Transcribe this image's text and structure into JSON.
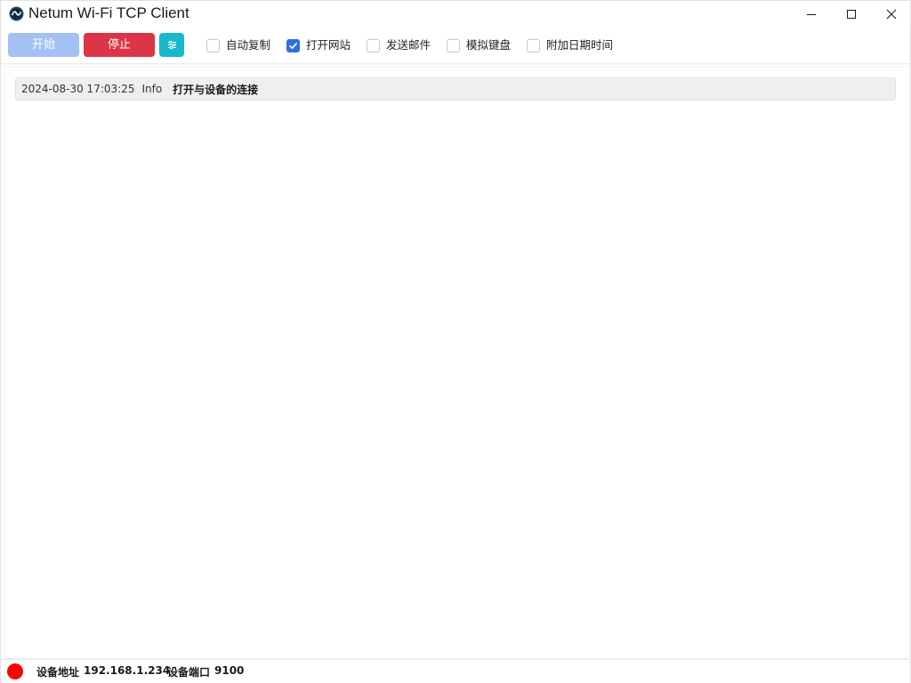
{
  "window": {
    "title": "Netum Wi-Fi TCP Client",
    "icon": "netum-logo-icon",
    "controls": {
      "minimize": "minimize-icon",
      "maximize": "maximize-icon",
      "close": "close-icon"
    }
  },
  "toolbar": {
    "start_label": "开始",
    "stop_label": "停止",
    "settings_icon": "settings-sliders-icon",
    "options": [
      {
        "label": "自动复制",
        "checked": false
      },
      {
        "label": "打开网站",
        "checked": true
      },
      {
        "label": "发送邮件",
        "checked": false
      },
      {
        "label": "模拟键盘",
        "checked": false
      },
      {
        "label": "附加日期时间",
        "checked": false
      }
    ]
  },
  "log": {
    "entries": [
      {
        "time": "2024-08-30 17:03:25",
        "level": "Info",
        "message": "打开与设备的连接"
      }
    ]
  },
  "status": {
    "indicator_color": "#ff0000",
    "address_label": "设备地址",
    "address_value": "192.168.1.234",
    "port_label": "设备端口",
    "port_value": "9100"
  },
  "colors": {
    "start_button": "#a4c1f4",
    "stop_button": "#dc3545",
    "settings_button": "#17b8cc",
    "checkbox_checked": "#2f6fe0"
  }
}
